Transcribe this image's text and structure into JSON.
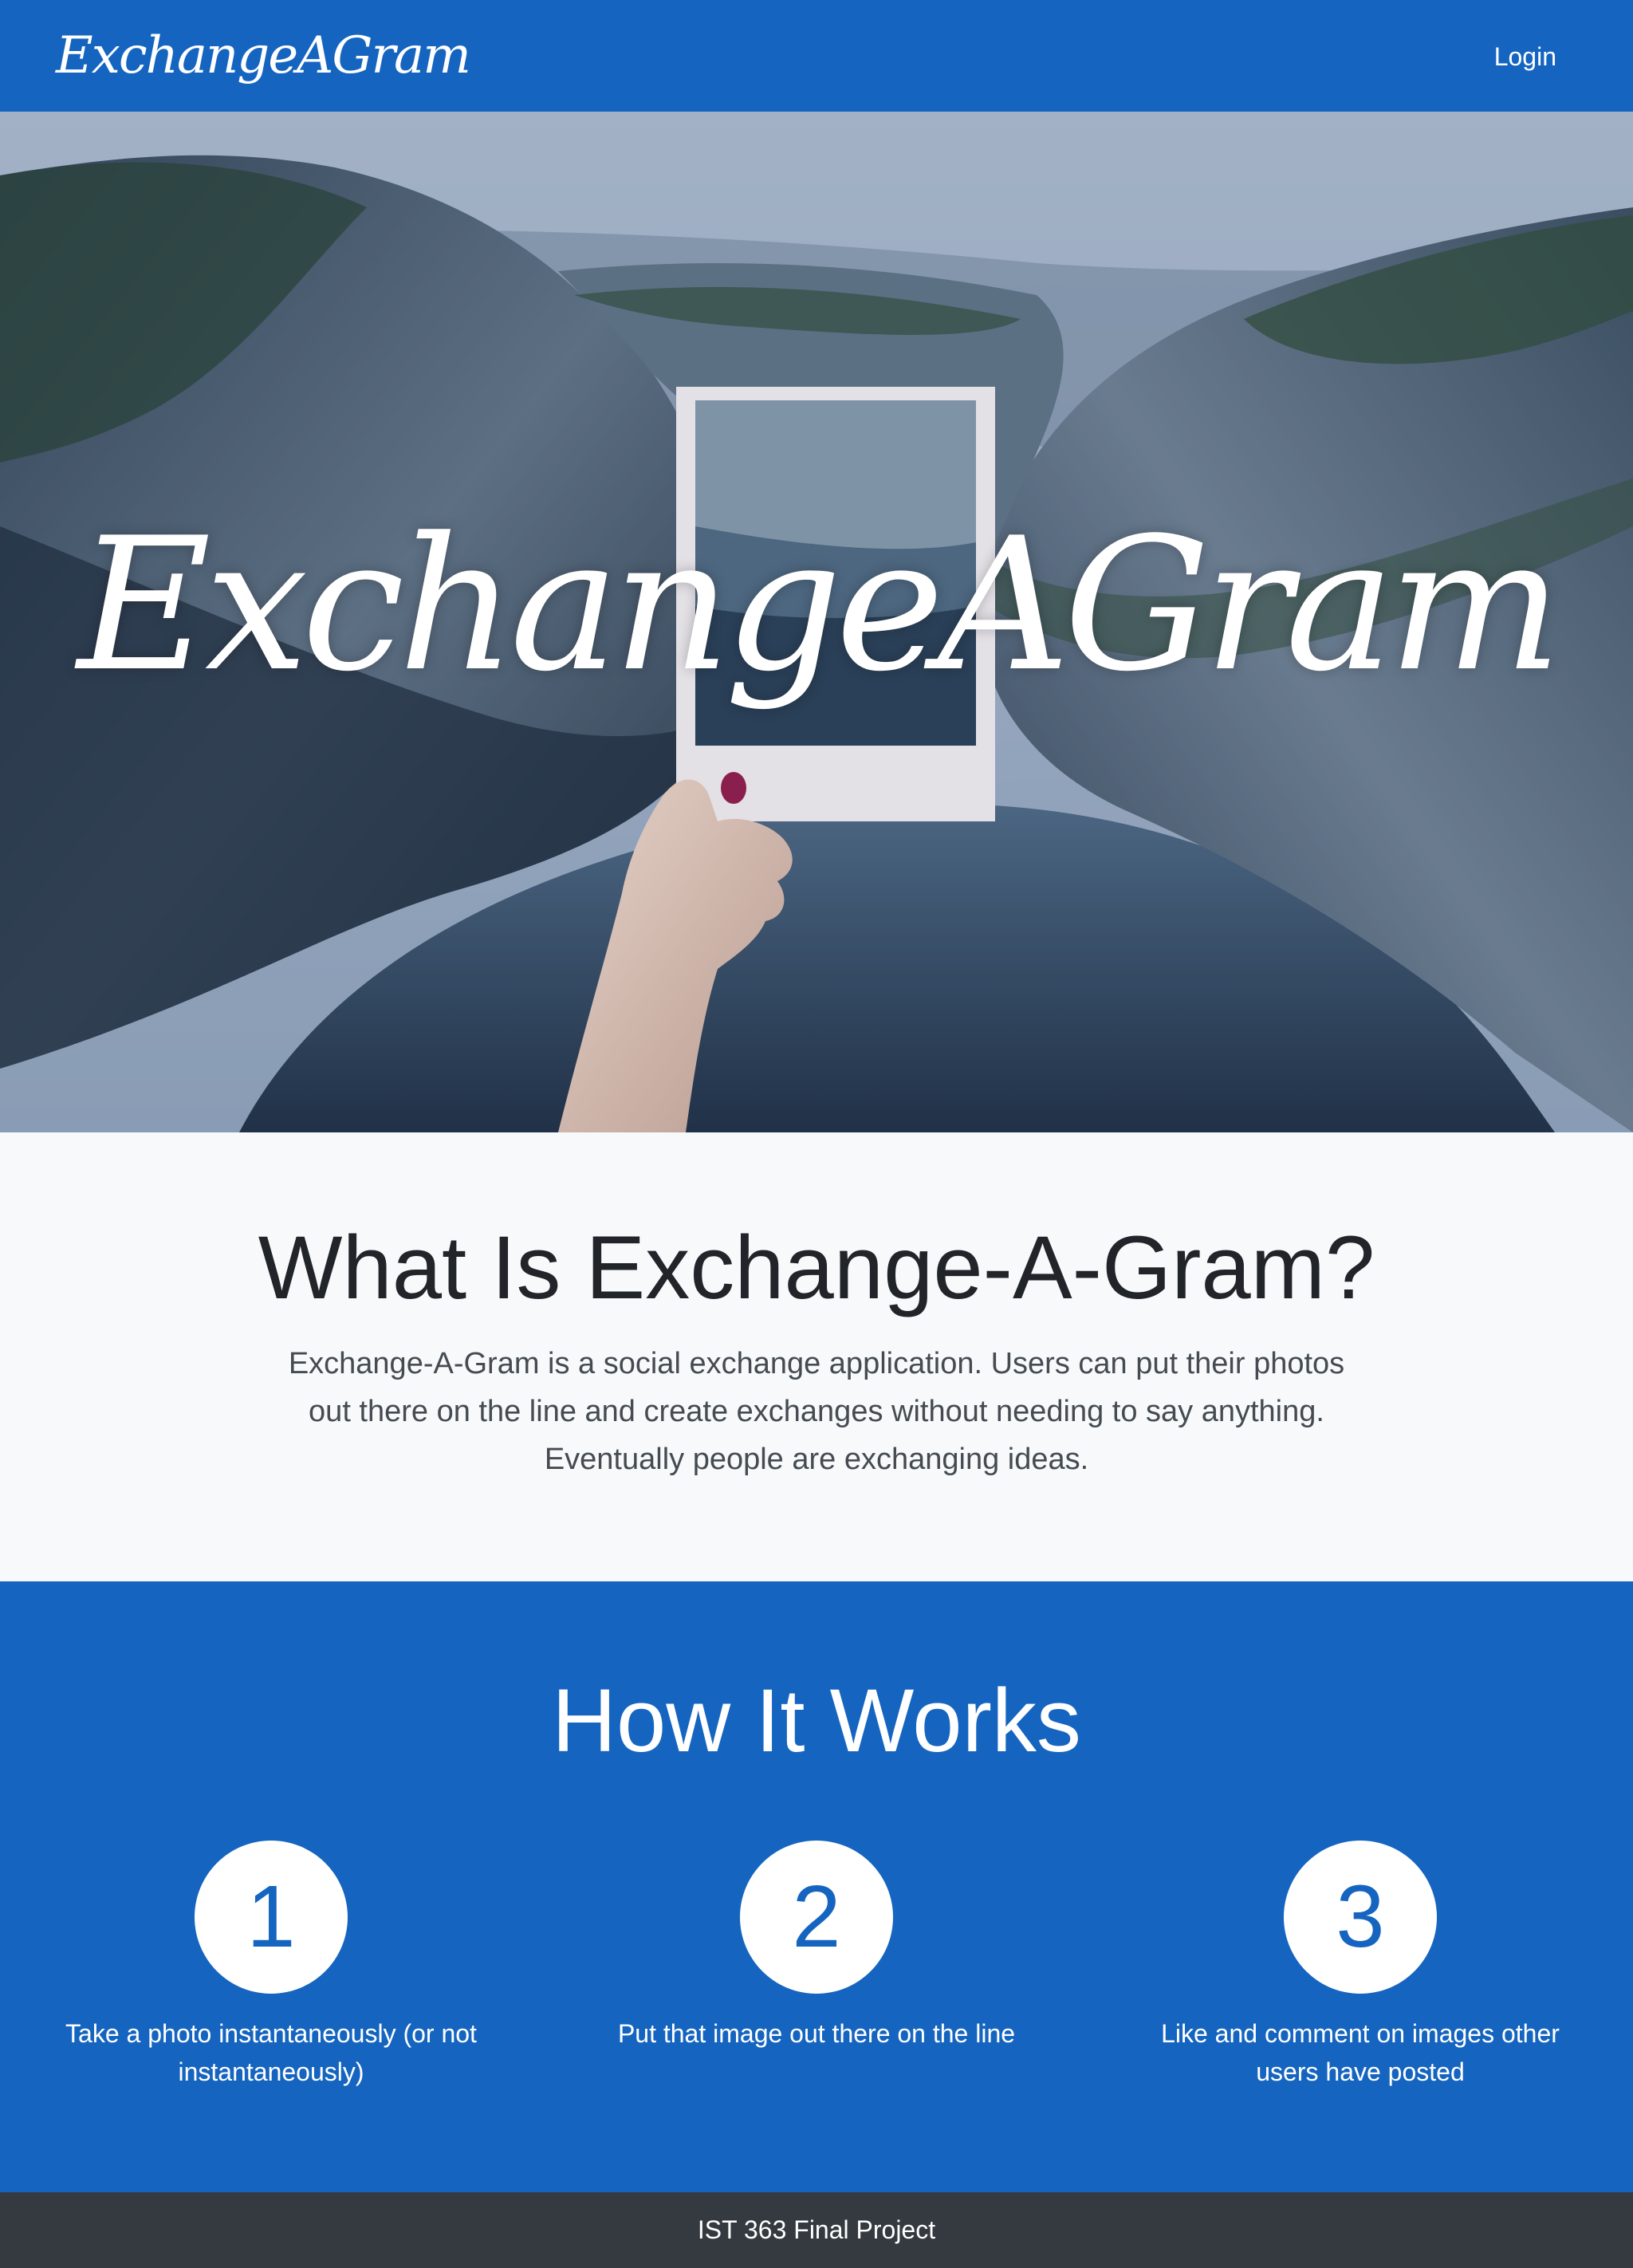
{
  "navbar": {
    "brand": "ExchangeAGram",
    "login": "Login"
  },
  "hero": {
    "title": "ExchangeAGram"
  },
  "about": {
    "title": "What Is Exchange-A-Gram?",
    "text": "Exchange-A-Gram is a social exchange application. Users can put their photos out there on the line and create exchanges without needing to say anything. Eventually people are exchanging ideas."
  },
  "how": {
    "title": "How It Works",
    "steps": [
      {
        "number": "1",
        "text": "Take a photo instantaneously (or not instantaneously)"
      },
      {
        "number": "2",
        "text": "Put that image out there on the line"
      },
      {
        "number": "3",
        "text": "Like and comment on images other users have posted"
      }
    ]
  },
  "footer": {
    "text": "IST 363 Final Project"
  },
  "colors": {
    "primary": "#1565c0",
    "footer": "#343a40",
    "light": "#f8f9fa"
  }
}
